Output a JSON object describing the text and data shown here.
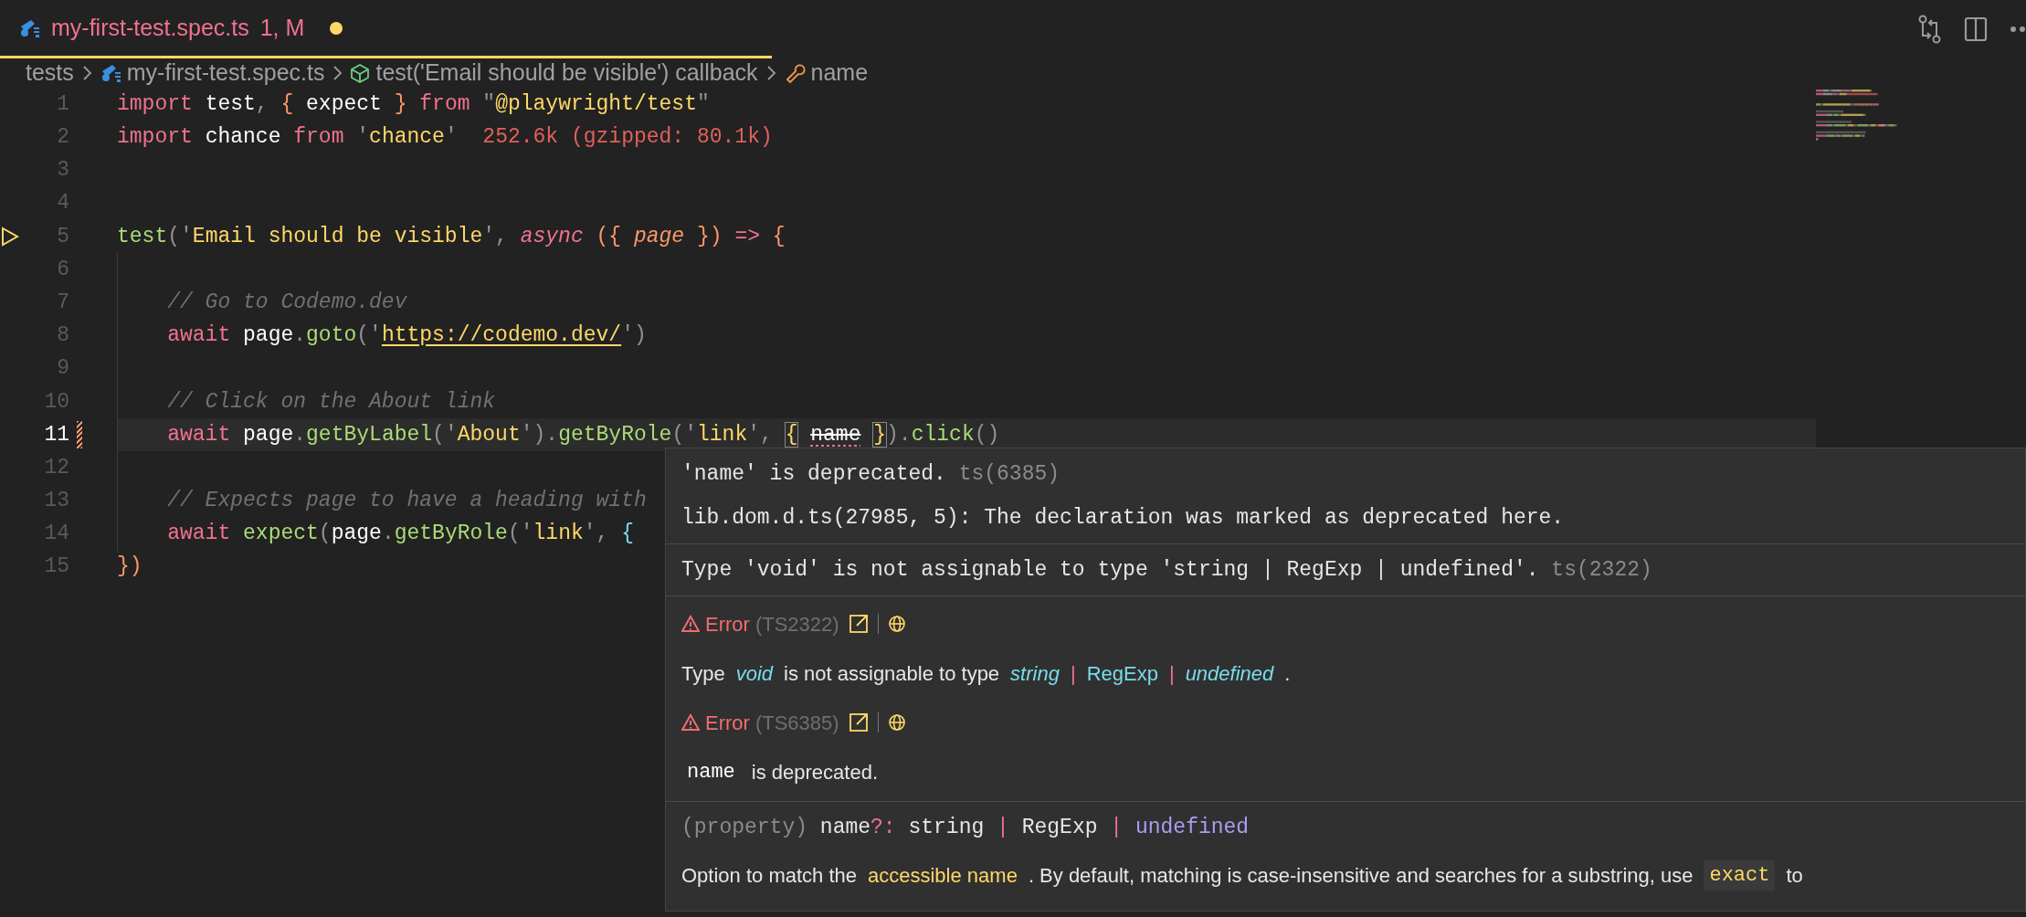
{
  "tab": {
    "filename": "my-first-test.spec.ts",
    "status": "1, M",
    "unsaved": true,
    "selected": true
  },
  "breadcrumb": [
    {
      "kind": "folder",
      "label": "tests"
    },
    {
      "kind": "file",
      "label": "my-first-test.spec.ts"
    },
    {
      "kind": "function",
      "label": "test('Email should be visible') callback"
    },
    {
      "kind": "field",
      "label": "name"
    }
  ],
  "lines": [
    {
      "number": "1",
      "current": false,
      "kind": "plain",
      "tokens": [
        {
          "text": "import",
          "kind": "keyword"
        },
        {
          "text": " test",
          "kind": "plain"
        },
        {
          "text": ", ",
          "kind": "punct"
        },
        {
          "text": "{",
          "kind": "brace"
        },
        {
          "text": " expect ",
          "kind": "plain"
        },
        {
          "text": "}",
          "kind": "brace"
        },
        {
          "text": " from ",
          "kind": "keyword"
        },
        {
          "text": "\"",
          "kind": "punct"
        },
        {
          "text": "@playwright/test",
          "kind": "string"
        },
        {
          "text": "\"",
          "kind": "punct"
        }
      ]
    },
    {
      "number": "2",
      "current": false,
      "kind": "plain",
      "tokens": [
        {
          "text": "import",
          "kind": "keyword"
        },
        {
          "text": " chance ",
          "kind": "plain"
        },
        {
          "text": "from",
          "kind": "keyword"
        },
        {
          "text": " '",
          "kind": "punct"
        },
        {
          "text": "chance",
          "kind": "string"
        },
        {
          "text": "'",
          "kind": "punct"
        },
        {
          "text": "  252.6k (gzipped: 80.1k)",
          "kind": "size"
        }
      ]
    },
    {
      "number": "3",
      "current": false,
      "kind": "plain"
    },
    {
      "number": "4",
      "current": false,
      "kind": "plain"
    },
    {
      "number": "5",
      "current": false,
      "kind": "runnable",
      "tokens": [
        {
          "text": "test",
          "kind": "function"
        },
        {
          "text": "('",
          "kind": "punct"
        },
        {
          "text": "Email should be visible",
          "kind": "string"
        },
        {
          "text": "', ",
          "kind": "punct"
        },
        {
          "text": "async",
          "kind": "keyword_italic"
        },
        {
          "text": " ({ ",
          "kind": "brace"
        },
        {
          "text": "page",
          "kind": "param"
        },
        {
          "text": " })",
          "kind": "brace"
        },
        {
          "text": " => ",
          "kind": "keyword"
        },
        {
          "text": "{",
          "kind": "brace"
        }
      ]
    },
    {
      "number": "6",
      "current": false,
      "kind": "plain"
    },
    {
      "number": "7",
      "current": false,
      "kind": "plain",
      "tokens": [
        {
          "text": "    // Go to Codemo.dev",
          "kind": "comment"
        }
      ]
    },
    {
      "number": "8",
      "current": false,
      "kind": "plain",
      "tokens": [
        {
          "text": "    await",
          "kind": "keyword"
        },
        {
          "text": " page",
          "kind": "plain"
        },
        {
          "text": ".",
          "kind": "punct"
        },
        {
          "text": "goto",
          "kind": "function"
        },
        {
          "text": "('",
          "kind": "punct"
        },
        {
          "text": "https://codemo.dev/",
          "kind": "link"
        },
        {
          "text": "')",
          "kind": "punct"
        }
      ]
    },
    {
      "number": "9",
      "current": false,
      "kind": "plain"
    },
    {
      "number": "10",
      "current": false,
      "kind": "plain",
      "tokens": [
        {
          "text": "    // Click on the About link",
          "kind": "comment"
        }
      ]
    },
    {
      "number": "11",
      "current": true,
      "kind": "modified",
      "tokens": [
        {
          "text": "    await",
          "kind": "keyword"
        },
        {
          "text": " page",
          "kind": "plain"
        },
        {
          "text": ".",
          "kind": "punct"
        },
        {
          "text": "getByLabel",
          "kind": "function"
        },
        {
          "text": "('",
          "kind": "punct"
        },
        {
          "text": "About",
          "kind": "string"
        },
        {
          "text": "')",
          "kind": "punct"
        },
        {
          "text": ".",
          "kind": "punct"
        },
        {
          "text": "getByRole",
          "kind": "function"
        },
        {
          "text": "('",
          "kind": "punct"
        },
        {
          "text": "link",
          "kind": "string"
        },
        {
          "text": "', ",
          "kind": "punct"
        },
        {
          "text": "{",
          "kind": "matched"
        },
        {
          "text": "name",
          "kind": "deprecated"
        },
        {
          "text": "}",
          "kind": "matched"
        },
        {
          "text": ").",
          "kind": "punct"
        },
        {
          "text": "click",
          "kind": "function"
        },
        {
          "text": "()",
          "kind": "punct"
        }
      ]
    },
    {
      "number": "12",
      "current": false,
      "kind": "plain"
    },
    {
      "number": "13",
      "current": false,
      "kind": "plain",
      "tokens": [
        {
          "text": "    // Expects page to have a heading with",
          "kind": "comment"
        }
      ]
    },
    {
      "number": "14",
      "current": false,
      "kind": "plain",
      "tokens": [
        {
          "text": "    await",
          "kind": "keyword"
        },
        {
          "text": " expect",
          "kind": "function"
        },
        {
          "text": "(",
          "kind": "punct"
        },
        {
          "text": "page",
          "kind": "plain"
        },
        {
          "text": ".",
          "kind": "punct"
        },
        {
          "text": "getByRole",
          "kind": "function"
        },
        {
          "text": "('",
          "kind": "punct"
        },
        {
          "text": "link",
          "kind": "string"
        },
        {
          "text": "', ",
          "kind": "punct"
        },
        {
          "text": "{",
          "kind": "bracket2"
        }
      ]
    },
    {
      "number": "15",
      "current": false,
      "kind": "plain",
      "tokens": [
        {
          "text": "})",
          "kind": "brace"
        }
      ]
    }
  ],
  "hover": {
    "sections": [
      {
        "rows": [
          {
            "kind": "mono",
            "segments": [
              {
                "text": "'name' is deprecated.",
                "kind": "plain"
              },
              {
                "text": " ts(6385)",
                "kind": "muted"
              }
            ]
          },
          {
            "kind": "mono",
            "segments": [
              {
                "text": "lib.dom.d.ts(27985, 5): The declaration was marked as deprecated here.",
                "kind": "plain"
              }
            ]
          }
        ]
      },
      {
        "rows": [
          {
            "kind": "mono",
            "segments": [
              {
                "text": "Type 'void' is not assignable to type 'string | RegExp | undefined'.",
                "kind": "plain"
              },
              {
                "text": " ts(2322)",
                "kind": "muted"
              }
            ]
          }
        ]
      },
      {
        "rows": [
          {
            "kind": "error_header",
            "label": "Error",
            "code": "(TS2322)"
          },
          {
            "kind": "prose",
            "segments": [
              {
                "text": "Type",
                "kind": "plain"
              },
              {
                "text": "void",
                "kind": "cyan_italic"
              },
              {
                "text": "is not assignable to type",
                "kind": "plain"
              },
              {
                "text": "string",
                "kind": "cyan_italic"
              },
              {
                "text": "|",
                "kind": "pink"
              },
              {
                "text": "RegExp",
                "kind": "cyan"
              },
              {
                "text": "|",
                "kind": "pink"
              },
              {
                "text": "undefined",
                "kind": "cyan_italic"
              },
              {
                "text": ".",
                "kind": "plain"
              }
            ]
          },
          {
            "kind": "error_header",
            "label": "Error",
            "code": "(TS6385)"
          },
          {
            "kind": "prose",
            "segments": [
              {
                "text": "name",
                "kind": "code"
              },
              {
                "text": "is deprecated.",
                "kind": "plain"
              }
            ]
          }
        ]
      },
      {
        "rows": [
          {
            "kind": "mono",
            "segments": [
              {
                "text": "(property)",
                "kind": "muted"
              },
              {
                "text": " name",
                "kind": "plain"
              },
              {
                "text": "?:",
                "kind": "pink"
              },
              {
                "text": " string ",
                "kind": "plain"
              },
              {
                "text": "|",
                "kind": "pink"
              },
              {
                "text": " RegExp ",
                "kind": "plain"
              },
              {
                "text": "|",
                "kind": "pink"
              },
              {
                "text": " undefined",
                "kind": "purple"
              }
            ]
          },
          {
            "kind": "prose",
            "segments": [
              {
                "text": "Option to match the",
                "kind": "plain"
              },
              {
                "text": "accessible name",
                "kind": "yellow"
              },
              {
                "text": ". By default, matching is case-insensitive and searches for a substring, use",
                "kind": "plain"
              },
              {
                "text": "exact",
                "kind": "yellow_code"
              },
              {
                "text": "to",
                "kind": "plain"
              }
            ]
          }
        ]
      }
    ]
  }
}
